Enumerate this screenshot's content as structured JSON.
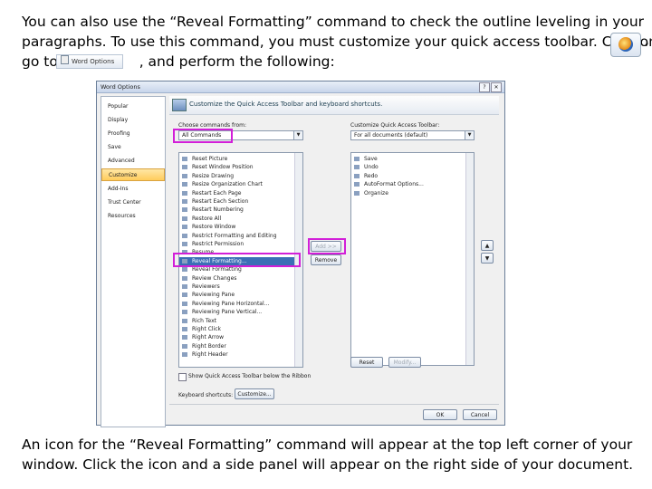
{
  "intro": {
    "line1": "You can also use the “Reveal Formatting” command to check the outline leveling in your",
    "line2": "paragraphs. To use this command, you must customize your quick access toolbar. Click on",
    "line3_start": "go to",
    "line3_end": ", and perform the following:",
    "trailing_comma": ","
  },
  "inline_word_options_button": "Word Options",
  "dialog": {
    "title": "Word Options",
    "help_label": "?",
    "close_label": "✕",
    "header_title": "Customize the Quick Access Toolbar and keyboard shortcuts.",
    "nav": [
      "Popular",
      "Display",
      "Proofing",
      "Save",
      "Advanced",
      "Customize",
      "Add-Ins",
      "Trust Center",
      "Resources"
    ],
    "nav_selected": "Customize",
    "choose_label": "Choose commands from:",
    "choose_value": "All Commands",
    "customize_label": "Customize Quick Access Toolbar:",
    "customize_value": "For all documents (default)",
    "commands": [
      "Reset Picture",
      "Reset Window Position",
      "Resize Drawing",
      "Resize Organization Chart",
      "Restart Each Page",
      "Restart Each Section",
      "Restart Numbering",
      "Restore All",
      "Restore Window",
      "Restrict Formatting and Editing",
      "Restrict Permission",
      "Resume",
      "Reveal Formatting...",
      "Reveal Formatting",
      "Review Changes",
      "Reviewers",
      "Reviewing Pane",
      "Reviewing Pane Horizontal...",
      "Reviewing Pane Vertical...",
      "Rich Text",
      "Right Click",
      "Right Arrow",
      "Right Border",
      "Right Header"
    ],
    "selected_command": "Reveal Formatting...",
    "qat_items": [
      "Save",
      "Undo",
      "Redo",
      "AutoFormat Options...",
      "Organize"
    ],
    "add_label": "Add >>",
    "remove_label": "Remove",
    "reset_label": "Reset",
    "modify_label": "Modify...",
    "show_qat_label": "Show Quick Access Toolbar below the Ribbon",
    "keyboard_label": "Keyboard shortcuts:",
    "customize_btn": "Customize...",
    "ok_label": "OK",
    "cancel_label": "Cancel",
    "up_arrow": "▲",
    "down_arrow": "▼"
  },
  "outro": {
    "line1": "An icon for the “Reveal Formatting” command will appear at the top  left corner of your",
    "line2": "window. Click the icon and a side panel will appear on the right side of your document."
  },
  "colors": {
    "highlight": "#d21fd8",
    "selection": "#3b6fb6",
    "nav_selected": "#ffcc5c"
  }
}
